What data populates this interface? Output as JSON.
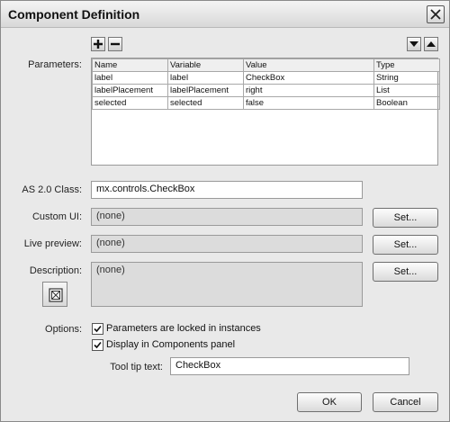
{
  "dialog": {
    "title": "Component Definition",
    "close_icon": "close-x-icon"
  },
  "parameters": {
    "label": "Parameters:",
    "add_icon": "plus-icon",
    "remove_icon": "minus-icon",
    "move_down_icon": "triangle-down-icon",
    "move_up_icon": "triangle-up-icon",
    "columns": [
      "Name",
      "Variable",
      "Value",
      "Type"
    ],
    "rows": [
      [
        "label",
        "label",
        "CheckBox",
        "String"
      ],
      [
        "labelPlacement",
        "labelPlacement",
        "right",
        "List"
      ],
      [
        "selected",
        "selected",
        "false",
        "Boolean"
      ]
    ]
  },
  "as_class": {
    "label": "AS 2.0 Class:",
    "value": "mx.controls.CheckBox"
  },
  "custom_ui": {
    "label": "Custom UI:",
    "value": "(none)",
    "button": "Set..."
  },
  "live_preview": {
    "label": "Live preview:",
    "value": "(none)",
    "button": "Set..."
  },
  "description": {
    "label": "Description:",
    "value": "(none)",
    "button": "Set...",
    "icon": "description-icon"
  },
  "options": {
    "label": "Options:",
    "lock_params": {
      "label": "Parameters are locked in instances",
      "checked": true
    },
    "display_in_panel": {
      "label": "Display in Components panel",
      "checked": true
    }
  },
  "tooltip": {
    "label": "Tool tip text:",
    "value": "CheckBox"
  },
  "footer": {
    "ok": "OK",
    "cancel": "Cancel"
  }
}
